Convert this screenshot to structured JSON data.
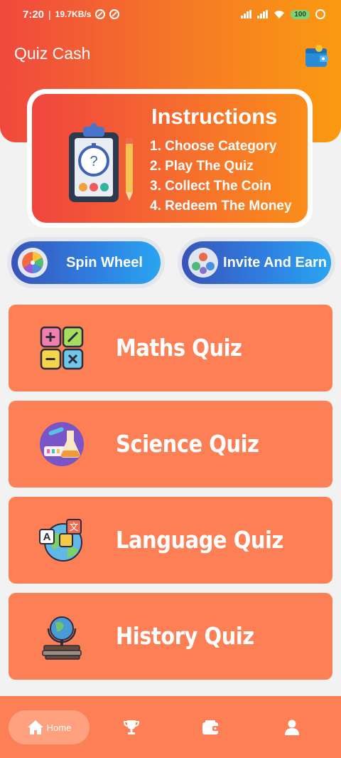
{
  "status_bar": {
    "time": "7:20",
    "speed": "19.7KB/s",
    "battery": "100"
  },
  "header": {
    "title": "Quiz Cash",
    "wallet_icon": "wallet-icon"
  },
  "instructions": {
    "title": "Instructions",
    "steps": [
      "1. Choose Category",
      "2. Play The Quiz",
      "3. Collect The Coin",
      "4. Redeem The Money"
    ],
    "illustration": "clipboard-stopwatch-icon"
  },
  "actions": {
    "spin": {
      "label": "Spin Wheel",
      "icon": "spin-wheel-icon"
    },
    "invite": {
      "label": "Invite And Earn",
      "icon": "invite-people-icon"
    }
  },
  "quizzes": [
    {
      "label": "Maths Quiz",
      "icon": "maths-icon"
    },
    {
      "label": "Science Quiz",
      "icon": "science-icon"
    },
    {
      "label": "Language Quiz",
      "icon": "language-icon"
    },
    {
      "label": "History Quiz",
      "icon": "history-icon"
    }
  ],
  "nav": {
    "home_label": "Home",
    "items": [
      "home-icon",
      "trophy-icon",
      "wallet-icon",
      "profile-icon"
    ]
  },
  "colors": {
    "header_start": "#f0483e",
    "header_end": "#fb9a10",
    "card": "#fd7f55",
    "pill_start": "#3954b8",
    "pill_end": "#2aa5f0"
  }
}
